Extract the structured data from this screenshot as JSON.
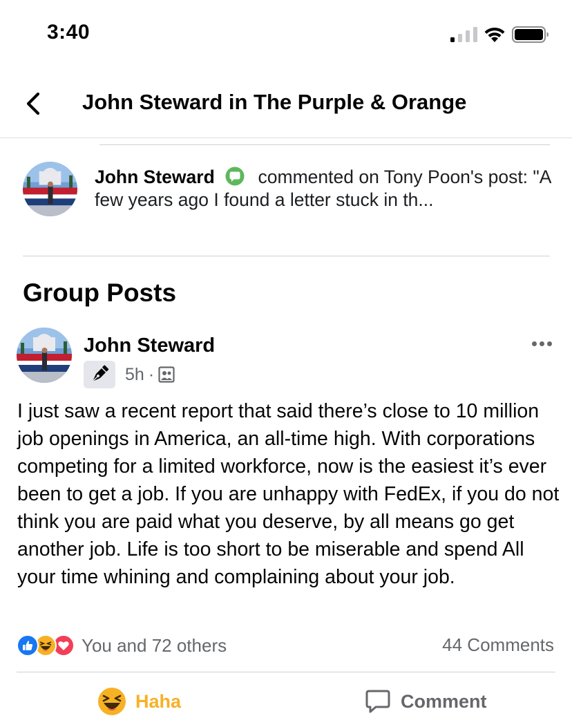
{
  "status_bar": {
    "time": "3:40"
  },
  "header": {
    "title": "John Steward in The Purple & Orange",
    "back_icon": "chevron-left-icon"
  },
  "notification": {
    "name": "John Steward",
    "action": "commented on Tony Poon's post: \"A few years ago I found a letter stuck in th...",
    "badge_icon": "comment-bubble-icon",
    "badge_color": "#5cb85c"
  },
  "section": {
    "title": "Group Posts"
  },
  "post": {
    "author": "John Steward",
    "time": "5h",
    "separator": "·",
    "badge_icon": "pen-nib-icon",
    "audience_icon": "members-icon",
    "body": "I just saw a recent report that said there’s close to 10 million job openings in America, an all-time high. With corporations competing for a limited workforce, now is the easiest it’s ever been to get a job. If you are unhappy with FedEx, if you do not think you are paid what you deserve, by all means go get another job. Life is too short to be miserable and spend All your time whining and complaining about your job.",
    "reactions_text": "You and 72 others",
    "reaction_icons": [
      "like-icon",
      "haha-icon",
      "love-icon"
    ],
    "comments_text": "44 Comments"
  },
  "actions": {
    "haha_label": "Haha",
    "comment_label": "Comment"
  },
  "colors": {
    "like": "#1877f2",
    "haha": "#f7b125",
    "love": "#f33e58",
    "secondary_text": "#65676b",
    "divider": "#ccd0d5"
  }
}
